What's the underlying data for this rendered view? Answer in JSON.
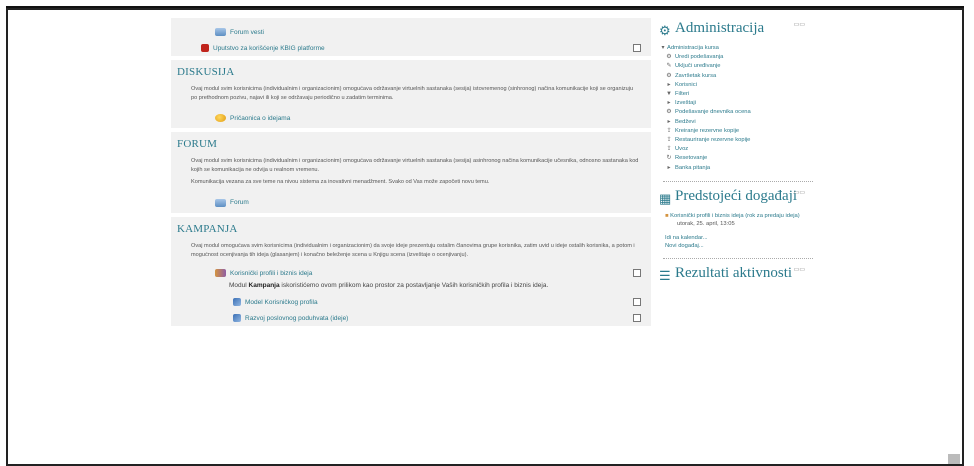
{
  "course": {
    "top_items": [
      {
        "label": "Forum vesti",
        "icon": "forum-icon",
        "checkbox": false
      },
      {
        "label": "Uputstvo za korišćenje KBIG platforme",
        "icon": "pdf-icon",
        "checkbox": true
      }
    ],
    "sections": [
      {
        "heading": "DISKUSIJA",
        "summary": [
          "Ovaj modul svim korisnicima (individualnim i organizacionim) omogućava održavanje virtuelnih sastanaka (sesija) istovremenog (sinhronog) načina komunikacije koji se organizuju po prethodnom pozivu, najavi ili koji se održavaju periodično u zadatim terminima."
        ],
        "items": [
          {
            "label": "Pričaonica o idejama",
            "icon": "chat-icon",
            "checkbox": false
          }
        ]
      },
      {
        "heading": "FORUM",
        "summary": [
          "Ovaj modul svim korisnicima (individualnim i organizacionim) omogućava održavanje virtuelnih sastanaka (sesija) asinhronog načina komunikacije učesnika, odnosno sastanaka kod kojih se komunikacija ne odvija u realnom vremenu.",
          "Komunikacija vezana za sve teme na nivou sistema za inovativni menadžment. Svako od Vas može započeti novu temu."
        ],
        "items": [
          {
            "label": "Forum",
            "icon": "forum-icon",
            "checkbox": false
          }
        ]
      },
      {
        "heading": "KAMPANJA",
        "summary": [
          "Ovaj modul omogućava svim korisnicima (individualnim i organizacionim) da svoje ideje prezentuju ostalim članovima grupe korisnika, zatim uvid u ideje ostalih korisnika, a potom i mogućnost ocenjivanja tih ideja (glasanjem) i konačno beleženje scena u Knjigu scena (izveštaje o ocenjivanju)."
        ],
        "items": [
          {
            "label": "Korisnički profili i biznis ideja",
            "icon": "users-icon",
            "checkbox": true
          },
          {
            "label": "Model Korisničkog profila",
            "icon": "assignment-icon",
            "checkbox": true
          },
          {
            "label": "Razvoj poslovnog poduhvata (ideje)",
            "icon": "assignment-icon",
            "checkbox": true
          }
        ],
        "description": {
          "before": "Modul ",
          "bold": "Kampanja",
          "after": " iskoristićemo ovom prilikom kao prostor za postavljanje Vaših korisničkih profila i biznis ideja."
        }
      }
    ]
  },
  "admin_block": {
    "title": "Administracija",
    "root": "Administracija kursa",
    "items": [
      {
        "label": "Uredi podešavanja",
        "glyph": "⚙",
        "icon": "gear-icon"
      },
      {
        "label": "Uključi uređivanje",
        "glyph": "✎",
        "icon": "pencil-icon"
      },
      {
        "label": "Završetak kursa",
        "glyph": "⚙",
        "icon": "gear-icon"
      },
      {
        "label": "Korisnici",
        "glyph": "▸",
        "icon": "expand-icon"
      },
      {
        "label": "Filteri",
        "glyph": "▼",
        "icon": "filter-icon"
      },
      {
        "label": "Izveštaji",
        "glyph": "▸",
        "icon": "expand-icon"
      },
      {
        "label": "Podešavanje dnevnika ocena",
        "glyph": "⚙",
        "icon": "gear-icon"
      },
      {
        "label": "Bedževi",
        "glyph": "▸",
        "icon": "expand-icon"
      },
      {
        "label": "Kreiranje rezervne kopije",
        "glyph": "⇪",
        "icon": "backup-icon"
      },
      {
        "label": "Restauriranje rezervne kopije",
        "glyph": "⇪",
        "icon": "restore-icon"
      },
      {
        "label": "Uvoz",
        "glyph": "⇪",
        "icon": "import-icon"
      },
      {
        "label": "Resetovanje",
        "glyph": "↻",
        "icon": "reset-icon"
      },
      {
        "label": "Banka pitanja",
        "glyph": "▸",
        "icon": "expand-icon"
      }
    ]
  },
  "events_block": {
    "title": "Predstojeći događaji",
    "event_title": "Korisnički profili i biznis ideja (rok za predaju ideja)",
    "event_date": "utorak, 25. april, 13:05",
    "link_calendar": "Idi na kalendar...",
    "link_new": "Novi događaj..."
  },
  "activity_block": {
    "title": "Rezultati aktivnosti"
  }
}
